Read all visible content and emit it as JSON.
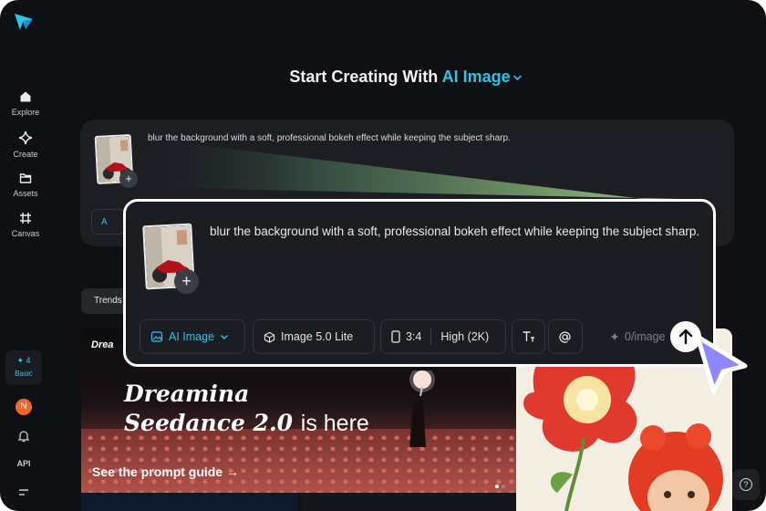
{
  "sidebar": {
    "items": [
      {
        "label": "Explore",
        "icon": "home-icon"
      },
      {
        "label": "Create",
        "icon": "sparkle-icon"
      },
      {
        "label": "Assets",
        "icon": "folder-icon"
      },
      {
        "label": "Canvas",
        "icon": "canvas-icon"
      }
    ],
    "credits": {
      "count": "✦ 4",
      "plan": "Basic"
    },
    "avatar": "N",
    "api_label": "API"
  },
  "headline": {
    "prefix": "Start Creating With",
    "mode": "AI Image"
  },
  "background_card": {
    "prompt": "blur the background with a soft, professional bokeh effect while keeping the subject sharp.",
    "chip": "A",
    "trends_label": "Trends"
  },
  "callout": {
    "prompt": "blur the background with a soft, professional bokeh effect while keeping the subject sharp.",
    "mode_label": "AI Image",
    "model_label": "Image 5.0 Lite",
    "ratio_label": "3:4",
    "quality_label": "High (2K)",
    "cost_label": "0/image",
    "plus": "+"
  },
  "banner": {
    "brand": "Drea",
    "title_line1": "Dreamina",
    "title_line2": "Seedance 2.0",
    "title_suffix": "is here",
    "cta": "See the prompt guide →",
    "slides_total": 2,
    "slide_active": 1
  },
  "help": {
    "label": "?"
  },
  "colors": {
    "accent": "#2dc3e8",
    "background": "#0f1013",
    "card": "#1c1e24",
    "pointer": "#8f86ff",
    "avatar": "#f0672d"
  }
}
